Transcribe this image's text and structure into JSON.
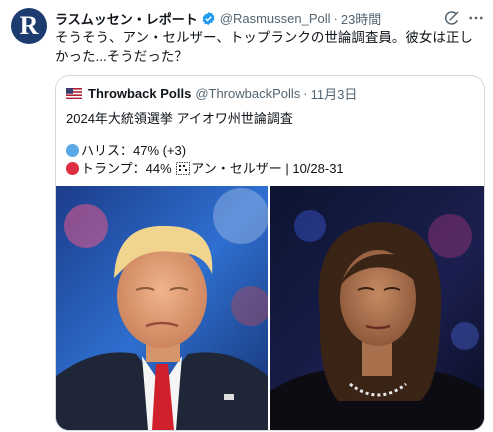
{
  "author": {
    "avatar_letter": "R",
    "display_name": "ラスムッセン・レポート",
    "handle": "@Rasmussen_Poll",
    "time": "23時間"
  },
  "tweet_text": "そうそう、アン・セルザー、トップランクの世論調査員。彼女は正しかった...そうだった？",
  "quote": {
    "display_name": "Throwback Polls",
    "handle": "@ThrowbackPolls",
    "date": "11月3日",
    "title": "2024年大統領選挙 アイオワ州世論調査",
    "line_harris": "ハリス：47% (+3)",
    "line_trump": "トランプ：44%",
    "line_trump_tail": "アン・セルザー | 10/28-31"
  },
  "colors": {
    "harris_circle": "#5aa9e6",
    "trump_circle": "#dd2e44",
    "verified_badge": "#1d9bf0",
    "avatar_bg": "#1c3b6e"
  },
  "icons": [
    "verified-badge-icon",
    "grok-icon",
    "more-options-icon",
    "us-flag-icon",
    "blue-circle-emoji",
    "red-circle-emoji"
  ]
}
